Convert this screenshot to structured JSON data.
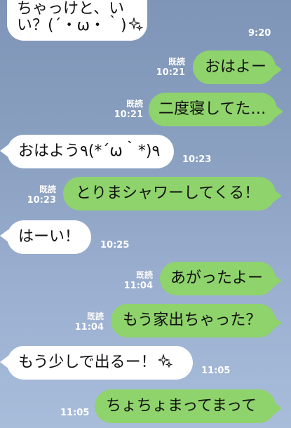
{
  "messages": [
    {
      "dir": "in",
      "line1": "ちゃっけと、い",
      "line2": "い？(´・ω・｀)",
      "sparkle": true,
      "time": "9:20"
    },
    {
      "dir": "out",
      "text": "おはよー",
      "read": "既読",
      "time": "10:21"
    },
    {
      "dir": "out",
      "text": "二度寝してた…",
      "read": "既読",
      "time": "10:21"
    },
    {
      "dir": "in",
      "text": "おはよう٩(*´ω｀*)٩",
      "time": "10:23"
    },
    {
      "dir": "out",
      "text": "とりまシャワーしてくる！",
      "read": "既読",
      "time": "10:23"
    },
    {
      "dir": "in",
      "text": "はーい！",
      "time": "10:25"
    },
    {
      "dir": "out",
      "text": "あがったよー",
      "read": "既読",
      "time": "11:04"
    },
    {
      "dir": "out",
      "text": "もう家出ちゃった？",
      "read": "既読",
      "time": "11:04"
    },
    {
      "dir": "in",
      "text": "もう少しで出るー！",
      "sparkle": true,
      "time": "11:05"
    },
    {
      "dir": "out",
      "text": "ちょちょまってまって",
      "time": "11:05"
    }
  ]
}
